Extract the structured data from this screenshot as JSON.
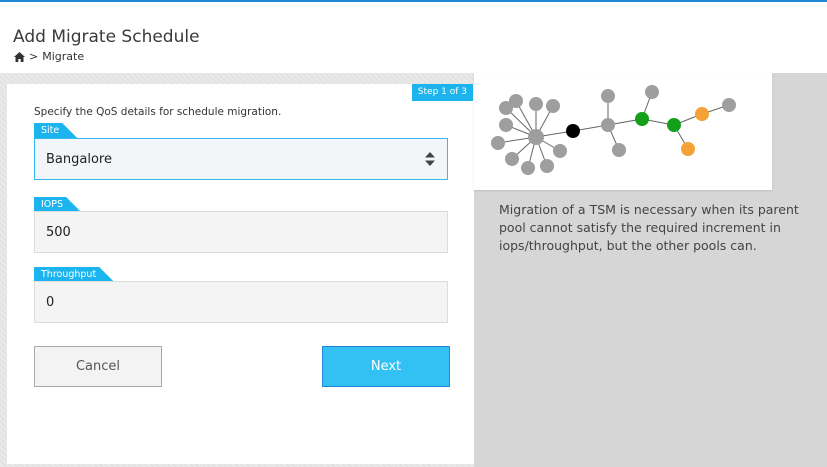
{
  "header": {
    "title": "Add Migrate Schedule",
    "breadcrumb": {
      "home_icon": "home-icon",
      "separator": ">",
      "current": "Migrate"
    }
  },
  "form": {
    "step": "Step 1 of 3",
    "intro": "Specify the QoS details for schedule migration.",
    "site": {
      "label": "Site",
      "value": "Bangalore"
    },
    "iops": {
      "label": "IOPS",
      "value": "500"
    },
    "throughput": {
      "label": "Throughput",
      "value": "0"
    },
    "buttons": {
      "cancel": "Cancel",
      "next": "Next"
    }
  },
  "info": {
    "description": "Migration of a TSM is necessary when its parent pool cannot satisfy the required increment in iops/throughput, but the other pools can."
  },
  "colors": {
    "accent": "#1cb4ef",
    "primary_button": "#33c0f3",
    "node_gray": "#9e9e9e",
    "node_black": "#000000",
    "node_green": "#14a01a",
    "node_orange": "#f4a238"
  }
}
